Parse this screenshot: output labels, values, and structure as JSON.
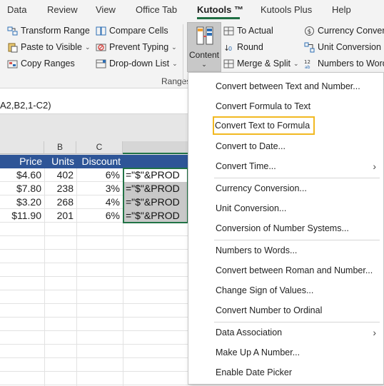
{
  "menubar": {
    "tabs": [
      "Data",
      "Review",
      "View",
      "Office Tab",
      "Kutools ™",
      "Kutools Plus",
      "Help"
    ],
    "active": "Kutools ™"
  },
  "ribbon": {
    "ranges_group": {
      "transform_range": "Transform Range",
      "paste_to_visible": "Paste to Visible",
      "copy_ranges": "Copy Ranges",
      "compare_cells": "Compare Cells",
      "prevent_typing": "Prevent Typing",
      "dropdown_list": "Drop-down List",
      "label": "Ranges"
    },
    "content_button": {
      "label": "Content",
      "caret": "⌄"
    },
    "right_group": {
      "to_actual": "To Actual",
      "round": "Round",
      "merge_split": "Merge & Split",
      "currency_conversion": "Currency Convers",
      "unit_conversion": "Unit Conversion",
      "numbers_to_words": "Numbers to Word"
    }
  },
  "formula_bar": {
    "text": "A2,B2,1-C2)"
  },
  "sheet": {
    "col_headers": [
      "B",
      "C"
    ],
    "header_row": [
      "Price",
      "Units",
      "Discount"
    ],
    "rows": [
      {
        "price": "$4.60",
        "units": "402",
        "discount": "6%",
        "formula": "=\"$\"&PROD"
      },
      {
        "price": "$7.80",
        "units": "238",
        "discount": "3%",
        "formula": "=\"$\"&PROD"
      },
      {
        "price": "$3.20",
        "units": "268",
        "discount": "4%",
        "formula": "=\"$\"&PROD"
      },
      {
        "price": "$11.90",
        "units": "201",
        "discount": "6%",
        "formula": "=\"$\"&PROD"
      }
    ]
  },
  "dropdown": {
    "items": [
      {
        "label": "Convert between Text and Number..."
      },
      {
        "label": "Convert Formula to Text"
      },
      {
        "label": "Convert Text to Formula",
        "highlighted": true
      },
      {
        "label": "Convert to Date..."
      },
      {
        "label": "Convert Time...",
        "submenu": true
      },
      {
        "label": "Currency Conversion..."
      },
      {
        "label": "Unit Conversion..."
      },
      {
        "label": "Conversion of Number Systems..."
      },
      {
        "label": "Numbers to Words..."
      },
      {
        "label": "Convert between Roman and Number..."
      },
      {
        "label": "Change Sign of Values..."
      },
      {
        "label": "Convert Number to Ordinal"
      },
      {
        "label": "Data Association",
        "submenu": true
      },
      {
        "label": "Make Up A Number..."
      },
      {
        "label": "Enable Date Picker"
      }
    ],
    "submenu_arrow": "›"
  },
  "colors": {
    "header_blue": "#2e5597",
    "selection_green": "#217346",
    "highlight_gold": "#f2b922",
    "tab_underline": "#1f6e43"
  }
}
